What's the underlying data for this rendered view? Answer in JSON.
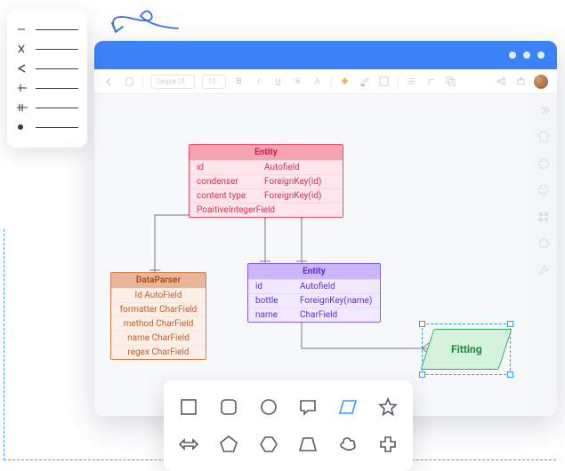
{
  "toolbar": {
    "font": "Segoe UI",
    "size": "10"
  },
  "entities": {
    "pink": {
      "title": "Entity",
      "rows": [
        {
          "k": "id",
          "v": "Autofield"
        },
        {
          "k": "condenser",
          "v": "ForeignKey(id)"
        },
        {
          "k": "content type",
          "v": "ForeignKey(id)"
        },
        {
          "k": "PoaitiveIntegerField",
          "v": ""
        }
      ]
    },
    "orange": {
      "title": "DataParser",
      "rows": [
        "Id AutoField",
        "formatter CharField",
        "method CharField",
        "name CharField",
        "regex CharField"
      ]
    },
    "purple": {
      "title": "Entity",
      "rows": [
        {
          "k": "id",
          "v": "Autofield"
        },
        {
          "k": "bottle",
          "v": "ForeignKey(name)"
        },
        {
          "k": "name",
          "v": "CharField"
        }
      ]
    }
  },
  "fitting_label": "Fitting"
}
